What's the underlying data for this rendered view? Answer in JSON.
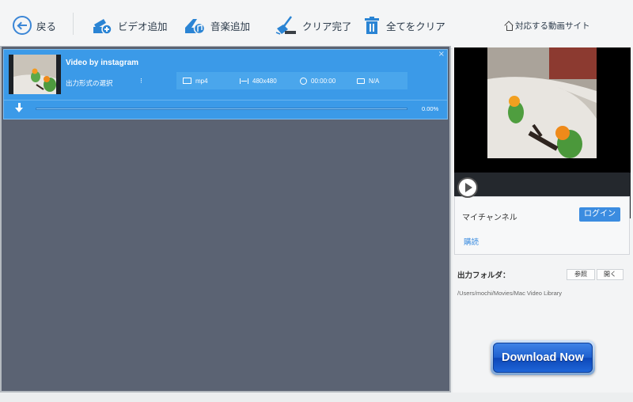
{
  "toolbar": {
    "back_label": "戻る",
    "add_video_label": "ビデオ追加",
    "add_music_label": "音楽追加",
    "clear_completed_label": "クリア完了",
    "clear_all_label": "全てをクリア",
    "supported_sites_label": "対応する動画サイト"
  },
  "task": {
    "title": "Video by instagram",
    "format_select_label": "出力形式の選択",
    "format": "mp4",
    "resolution": "480x480",
    "duration": "00:00:00",
    "size": "N/A",
    "progress_percent": 0,
    "progress_text": "0.00%"
  },
  "channel": {
    "label": "マイチャンネル",
    "login_label": "ログイン",
    "subscribe_label": "購読"
  },
  "output": {
    "label": "出力フォルダ：",
    "browse_label": "参照",
    "open_label": "開く",
    "path": "/Users/mochi/Movies/Mac Video Library"
  },
  "download_now_label": "Download Now",
  "colors": {
    "accent": "#3b9ae8",
    "panel_bg": "#5b6373",
    "icon_blue": "#2a84d4"
  }
}
